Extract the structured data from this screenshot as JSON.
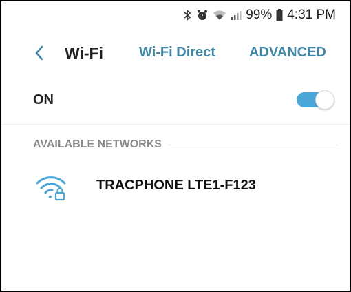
{
  "status_bar": {
    "icons": [
      "bluetooth-icon",
      "alarm-icon",
      "wifi-status-icon",
      "signal-icon",
      "battery-icon"
    ],
    "battery_text": "99%",
    "time": "4:31 PM"
  },
  "header": {
    "title": "Wi-Fi",
    "tab_wifi_direct": "Wi-Fi Direct",
    "tab_advanced": "ADVANCED"
  },
  "wifi_toggle": {
    "label": "ON",
    "state": "on"
  },
  "available_networks": {
    "section_title": "AVAILABLE NETWORKS",
    "items": [
      {
        "name": "TRACPHONE LTE1-F123",
        "icon": "wifi-locked-icon"
      }
    ]
  },
  "colors": {
    "accent": "#3f87a8",
    "toggle_on": "#4aa6d8",
    "wifi_icon": "#4aa6d8",
    "section_text": "#8a8a8a"
  }
}
